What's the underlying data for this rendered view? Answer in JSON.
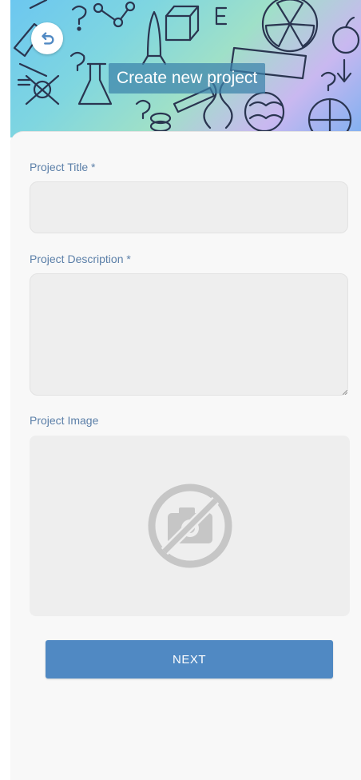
{
  "header": {
    "title": "Create new project",
    "back_icon": "back-arrow-icon"
  },
  "form": {
    "title_label": "Project Title *",
    "title_value": "",
    "description_label": "Project Description *",
    "description_value": "",
    "image_label": "Project Image",
    "image_placeholder_icon": "no-camera-icon",
    "next_label": "NEXT"
  },
  "colors": {
    "label": "#5b7fa8",
    "button": "#5089c3",
    "field_bg": "#eeeeee",
    "card_bg": "#f8f8f8"
  }
}
